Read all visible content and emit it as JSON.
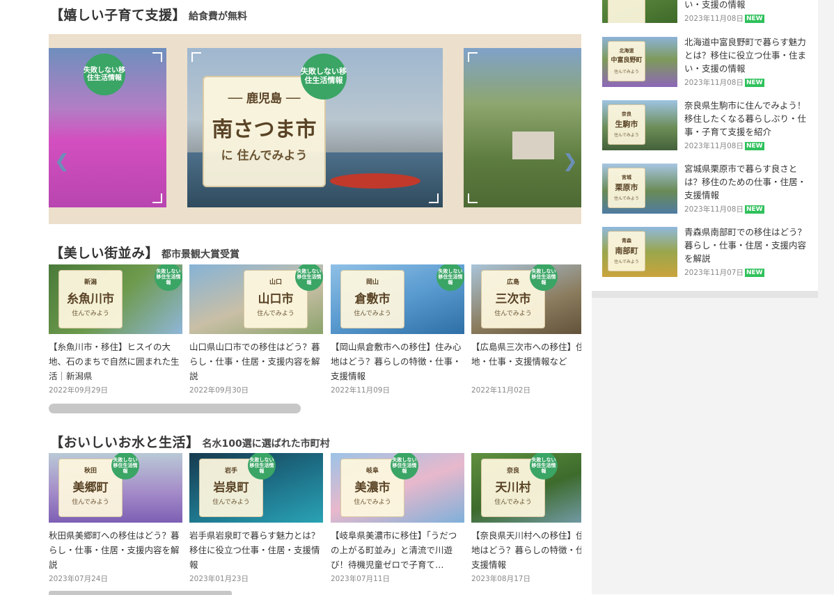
{
  "colors": {
    "accent_green": "#3aa565",
    "new_badge": "#2fc15b",
    "carousel_bg": "#ecdfcb",
    "sidebar_bg": "#f3f3f3"
  },
  "sections": {
    "kosodate": {
      "title": "【嬉しい子育て支援】",
      "subtitle": "給食費が無料"
    },
    "machinami": {
      "title": "【美しい街並み】",
      "subtitle": "都市景観大賞受賞"
    },
    "omizu": {
      "title": "【おいしいお水と生活】",
      "subtitle": "名水100選に選ばれた市町村"
    }
  },
  "carousel": {
    "badge": "失敗しない移住生活情報",
    "prev_icon": "chevron-left-icon",
    "next_icon": "chevron-right-icon",
    "slides": [
      {
        "pref": "",
        "city": "",
        "live": ""
      },
      {
        "pref": "── 鹿児島 ──",
        "city": "南さつま市",
        "live": "に 住んでみよう"
      },
      {
        "pref": "",
        "city": "",
        "live": ""
      }
    ]
  },
  "machinami_cards": [
    {
      "pref": "新潟",
      "city": "糸魚川市",
      "live": "住んでみよう",
      "title": "【糸魚川市・移住】ヒスイの大地、石のまちで自然に囲まれた生活｜新潟県",
      "date": "2022年09月29日"
    },
    {
      "pref": "山口",
      "city": "山口市",
      "live": "住んでみよう",
      "title": "山口県山口市での移住はどう？暮らし・仕事・住居・支援内容を解説",
      "date": "2022年09月30日"
    },
    {
      "pref": "岡山",
      "city": "倉敷市",
      "live": "住んでみよう",
      "title": "【岡山県倉敷市への移住】住み心地はどう？暮らしの特徴・仕事・支援情報",
      "date": "2022年11月09日"
    },
    {
      "pref": "広島",
      "city": "三次市",
      "live": "住んでみよう",
      "title": "【広島県三次市への移住】住み心地・仕事・支援情報など",
      "date": "2022年11月02日"
    }
  ],
  "omizu_cards": [
    {
      "pref": "秋田",
      "city": "美郷町",
      "live": "住んでみよう",
      "title": "秋田県美郷町への移住はどう？暮らし・仕事・住居・支援内容を解説",
      "date": "2023年07月24日"
    },
    {
      "pref": "岩手",
      "city": "岩泉町",
      "live": "住んでみよう",
      "title": "岩手県岩泉町で暮らす魅力とは？移住に役立つ仕事・住居・支援情報",
      "date": "2023年01月23日"
    },
    {
      "pref": "岐阜",
      "city": "美濃市",
      "live": "住んでみよう",
      "title": "【岐阜県美濃市に移住】「うだつの上がる町並み」と清流で川遊び！待機児童ゼロで子育て…",
      "date": "2023年07月11日"
    },
    {
      "pref": "奈良",
      "city": "天川村",
      "live": "住んでみよう",
      "title": "【奈良県天川村への移住】住み心地はどう？暮らしの特徴・仕事・支援情報",
      "date": "2023年08月17日"
    }
  ],
  "news": {
    "new_label": "NEW",
    "items": [
      {
        "pref": "",
        "city": "",
        "live": "",
        "title": "い・支援の情報",
        "date": "2023年11月08日"
      },
      {
        "pref": "北海道",
        "city": "中富良野町",
        "live": "住んでみよう",
        "title": "北海道中富良野町で暮らす魅力とは？移住に役立つ仕事・住まい・支援の情報",
        "date": "2023年11月08日"
      },
      {
        "pref": "奈良",
        "city": "生駒市",
        "live": "住んでみよう",
        "title": "奈良県生駒市に住んでみよう！移住したくなる暮らしぶり・仕事・子育て支援を紹介",
        "date": "2023年11月08日"
      },
      {
        "pref": "宮城",
        "city": "栗原市",
        "live": "住んでみよう",
        "title": "宮城県栗原市で暮らす良さとは？移住のための仕事・住居・支援情報",
        "date": "2023年11月08日"
      },
      {
        "pref": "青森",
        "city": "南部町",
        "live": "住んでみよう",
        "title": "青森県南部町での移住はどう？暮らし・仕事・住居・支援内容を解説",
        "date": "2023年11月07日"
      }
    ]
  }
}
